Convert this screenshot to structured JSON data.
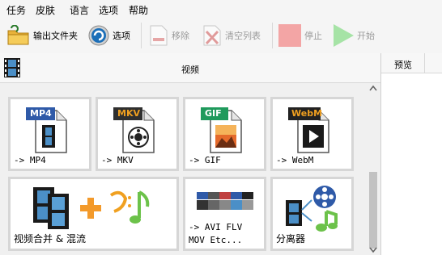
{
  "menu": [
    "任务",
    "皮肤",
    "语言",
    "选项",
    "帮助"
  ],
  "toolbar": {
    "output_folder": "输出文件夹",
    "options": "选项",
    "remove": "移除",
    "clear_list": "清空列表",
    "stop": "停止",
    "start": "开始"
  },
  "left_panel": {
    "title": "视频"
  },
  "right_panel": {
    "title": "预览"
  },
  "tiles": [
    {
      "badge": "MP4",
      "badge_color": "#2f5aa8",
      "label": "-> MP4"
    },
    {
      "badge": "MKV",
      "badge_color": "#2f2f2f",
      "label": "-> MKV"
    },
    {
      "badge": "GIF",
      "badge_color": "#1f9a5c",
      "label": "-> GIF"
    },
    {
      "badge": "WebM",
      "badge_color": "#222222",
      "label": "-> WebM"
    },
    {
      "label": "视频合并 & 混流"
    },
    {
      "label_line1": "-> AVI FLV",
      "label_line2": "MOV Etc..."
    },
    {
      "label": "分离器"
    }
  ],
  "colors": {
    "accent_blue": "#1c6fb8",
    "stop_red": "#f3a5a5",
    "start_green": "#a6e3a6"
  }
}
